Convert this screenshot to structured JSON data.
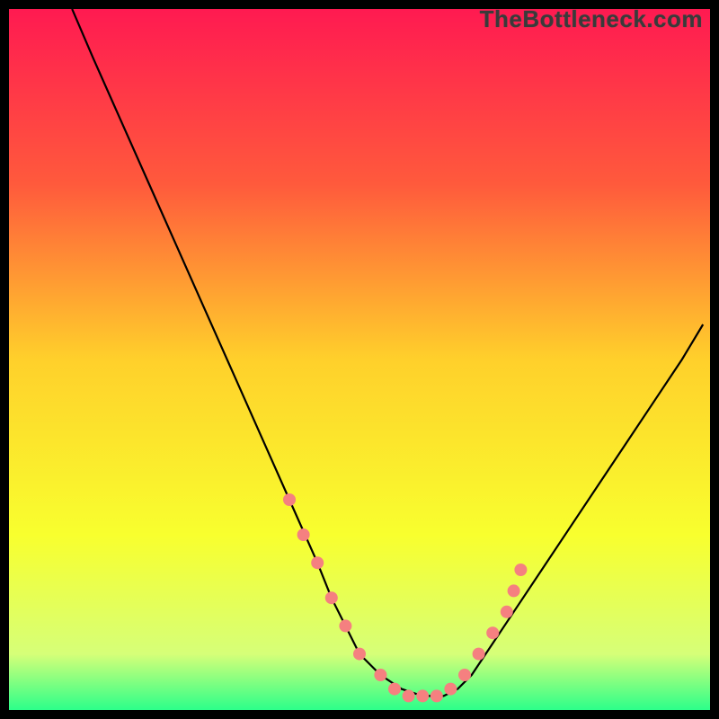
{
  "watermark": "TheBottleneck.com",
  "chart_data": {
    "type": "line",
    "title": "",
    "xlabel": "",
    "ylabel": "",
    "xlim": [
      0,
      100
    ],
    "ylim": [
      0,
      100
    ],
    "background_gradient": {
      "stops": [
        {
          "offset": 0.0,
          "color": "#ff1a51"
        },
        {
          "offset": 0.25,
          "color": "#ff5a3c"
        },
        {
          "offset": 0.5,
          "color": "#ffd02b"
        },
        {
          "offset": 0.75,
          "color": "#f8ff2e"
        },
        {
          "offset": 0.92,
          "color": "#d6ff78"
        },
        {
          "offset": 1.0,
          "color": "#2cff8a"
        }
      ]
    },
    "series": [
      {
        "name": "bottleneck-curve",
        "color": "#000000",
        "x": [
          9,
          12,
          16,
          20,
          24,
          28,
          32,
          36,
          40,
          44,
          46,
          48,
          50,
          53,
          56,
          59,
          62,
          64,
          66,
          68,
          72,
          76,
          80,
          84,
          88,
          92,
          96,
          99
        ],
        "y": [
          100,
          93,
          84,
          75,
          66,
          57,
          48,
          39,
          30,
          21,
          16,
          12,
          8,
          5,
          3,
          2,
          2,
          3,
          5,
          8,
          14,
          20,
          26,
          32,
          38,
          44,
          50,
          55
        ]
      }
    ],
    "markers": {
      "name": "highlight-dots",
      "color": "#f58080",
      "radius": 7,
      "points": [
        {
          "x": 40,
          "y": 30
        },
        {
          "x": 42,
          "y": 25
        },
        {
          "x": 44,
          "y": 21
        },
        {
          "x": 46,
          "y": 16
        },
        {
          "x": 48,
          "y": 12
        },
        {
          "x": 50,
          "y": 8
        },
        {
          "x": 53,
          "y": 5
        },
        {
          "x": 55,
          "y": 3
        },
        {
          "x": 57,
          "y": 2
        },
        {
          "x": 59,
          "y": 2
        },
        {
          "x": 61,
          "y": 2
        },
        {
          "x": 63,
          "y": 3
        },
        {
          "x": 65,
          "y": 5
        },
        {
          "x": 67,
          "y": 8
        },
        {
          "x": 69,
          "y": 11
        },
        {
          "x": 71,
          "y": 14
        },
        {
          "x": 72,
          "y": 17
        },
        {
          "x": 73,
          "y": 20
        }
      ]
    }
  }
}
